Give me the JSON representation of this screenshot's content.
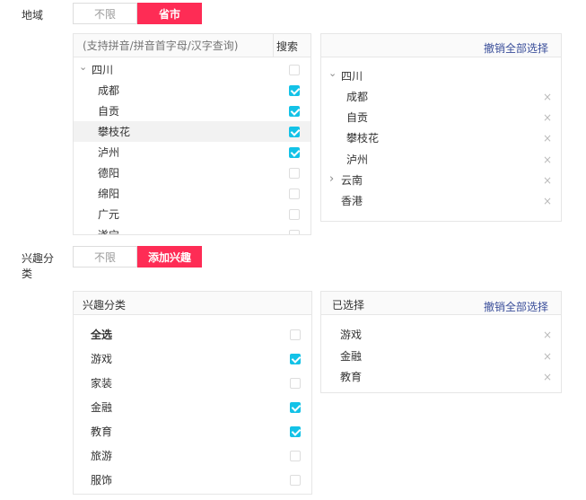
{
  "region": {
    "label": "地域",
    "options": [
      "不限",
      "省市"
    ],
    "search_placeholder": "(支持拼音/拼音首字母/汉字查询)",
    "search_button": "搜索",
    "tree": [
      {
        "label": "四川",
        "checked": false
      },
      {
        "label": "成都",
        "checked": true
      },
      {
        "label": "自贡",
        "checked": true
      },
      {
        "label": "攀枝花",
        "checked": true
      },
      {
        "label": "泸州",
        "checked": true
      },
      {
        "label": "德阳",
        "checked": false
      },
      {
        "label": "绵阳",
        "checked": false
      },
      {
        "label": "广元",
        "checked": false
      },
      {
        "label": "遂宁",
        "checked": false
      }
    ],
    "selected_clear": "撤销全部选择",
    "selected": [
      {
        "label": "四川"
      },
      {
        "label": "成都"
      },
      {
        "label": "自贡"
      },
      {
        "label": "攀枝花"
      },
      {
        "label": "泸州"
      },
      {
        "label": "云南"
      },
      {
        "label": "香港"
      }
    ]
  },
  "interest": {
    "label_line1": "兴趣分",
    "label_line2": "类",
    "options": [
      "不限",
      "添加兴趣"
    ],
    "panel_title": "兴趣分类",
    "items": [
      {
        "label": "全选",
        "checked": false
      },
      {
        "label": "游戏",
        "checked": true
      },
      {
        "label": "家装",
        "checked": false
      },
      {
        "label": "金融",
        "checked": true
      },
      {
        "label": "教育",
        "checked": true
      },
      {
        "label": "旅游",
        "checked": false
      },
      {
        "label": "服饰",
        "checked": false
      }
    ],
    "selected_title": "已选择",
    "selected_clear": "撤销全部选择",
    "selected": [
      {
        "label": "游戏"
      },
      {
        "label": "金融"
      },
      {
        "label": "教育"
      }
    ]
  },
  "icons": {
    "close": "×",
    "expanded": "⌄",
    "collapsed": "›"
  },
  "colors": {
    "accent": "#fe2c55",
    "check": "#13c2e7",
    "link": "#3a4e9a"
  }
}
